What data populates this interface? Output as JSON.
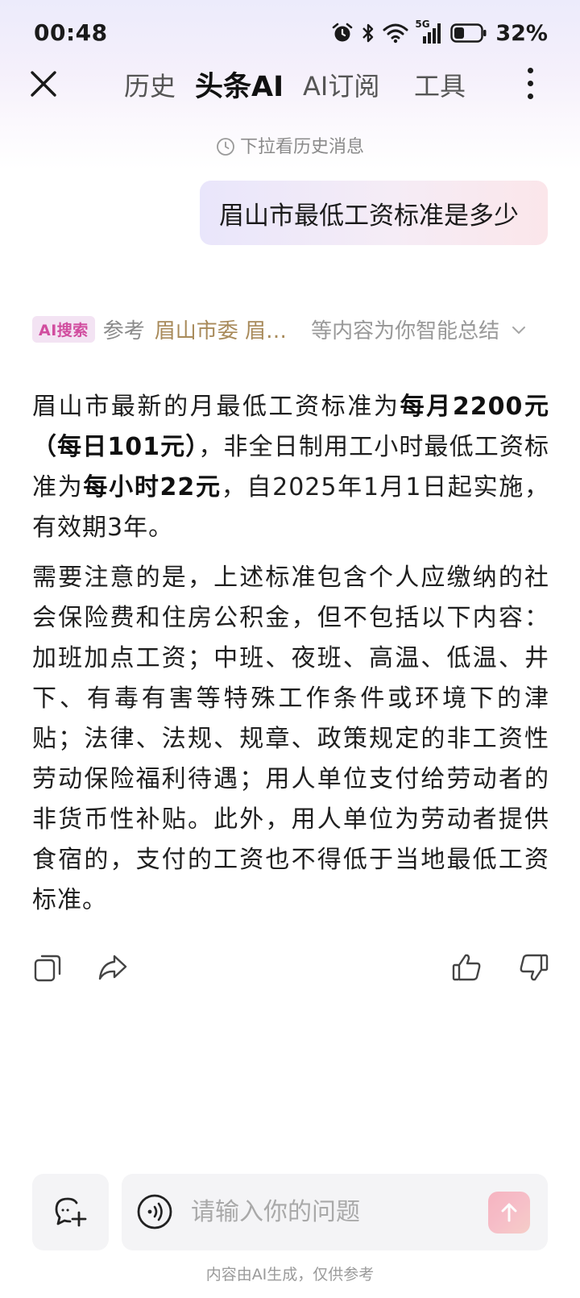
{
  "status": {
    "time": "00:48",
    "network_label": "5G",
    "battery": "32%",
    "icons": [
      "alarm-icon",
      "bluetooth-icon",
      "wifi-icon",
      "signal-5g-icon",
      "battery-icon"
    ]
  },
  "nav": {
    "tabs": [
      {
        "label": "历史"
      },
      {
        "label": "头条AI"
      },
      {
        "label": "AI订阅"
      },
      {
        "label": "工具"
      }
    ],
    "active_tab": "头条AI"
  },
  "history_hint": "下拉看历史消息",
  "user_message": "眉山市最低工资标准是多少",
  "source": {
    "badge": "AI搜索",
    "ref_label": "参考",
    "names": "眉山市委  眉…",
    "tail": "等内容为你智能总结"
  },
  "answer": {
    "p1_a": "眉山市最新的月最低工资标准为",
    "p1_b": "每月2200元（每日101元）",
    "p1_c": "，非全日制用工小时最低工资标准为",
    "p1_d": "每小时22元",
    "p1_e": "，自2025年1月1日起实施，有效期3年。",
    "p2": "需要注意的是，上述标准包含个人应缴纳的社会保险费和住房公积金，但不包括以下内容：加班加点工资；中班、夜班、高温、低温、井下、有毒有害等特殊工作条件或环境下的津贴；法律、法规、规章、政策规定的非工资性劳动保险福利待遇；用人单位支付给劳动者的非货币性补贴。此外，用人单位为劳动者提供食宿的，支付的工资也不得低于当地最低工资标准。"
  },
  "input": {
    "placeholder": "请输入你的问题",
    "value": ""
  },
  "disclaimer": "内容由AI生成，仅供参考",
  "colors": {
    "accent_pink": "#f7a9b8",
    "badge_purple": "#8a5cf0",
    "badge_pink": "#d14d9f",
    "source_gold": "#a88a5a"
  }
}
